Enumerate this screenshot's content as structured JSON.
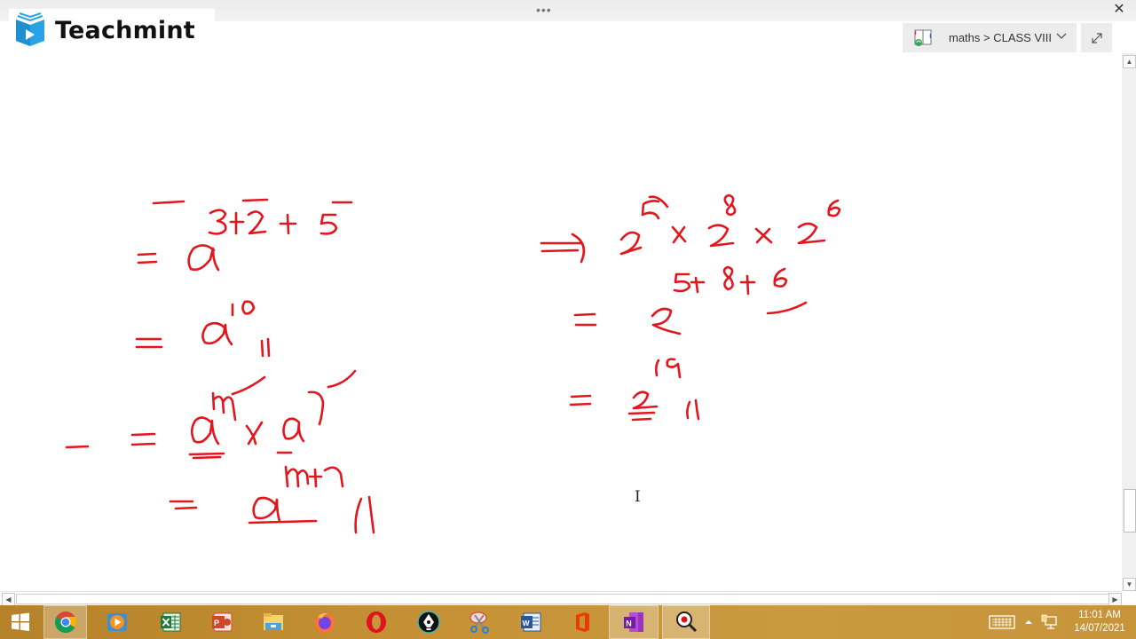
{
  "window": {
    "title_dots": "•••",
    "close_label": "✕"
  },
  "logo": {
    "brand": "Teachmint",
    "icon": "teachmint-book-play-icon"
  },
  "notebook": {
    "icon": "notebook-sync-icon",
    "label": "maths > CLASS VIII",
    "dropdown_icon": "chevron-down-icon",
    "expand_icon": "expand-diagonal-icon"
  },
  "canvas": {
    "ink_color": "#e3161e",
    "left_column": [
      {
        "line": "= a^(3+2+5)"
      },
      {
        "line": "= a^10 //"
      },
      {
        "line": "= a^m × a^n"
      },
      {
        "line": "= a^(m+n) //"
      }
    ],
    "right_column": [
      {
        "line": "⟹ 2^5 × 2^8 × 2^6"
      },
      {
        "line": "= 2^(5+8+6)"
      },
      {
        "line": "= 2^19 //"
      }
    ]
  },
  "scrollbars": {
    "up_arrow": "▲",
    "down_arrow": "▼",
    "left_arrow": "◀",
    "right_arrow": "▶"
  },
  "cursor": {
    "glyph": "I"
  },
  "taskbar": {
    "apps": [
      {
        "name": "start-button",
        "icon": "windows-logo-icon"
      },
      {
        "name": "chrome",
        "icon": "chrome-icon"
      },
      {
        "name": "media-player",
        "icon": "media-player-icon"
      },
      {
        "name": "excel",
        "icon": "excel-icon"
      },
      {
        "name": "powerpoint",
        "icon": "powerpoint-icon"
      },
      {
        "name": "file-explorer",
        "icon": "file-explorer-icon"
      },
      {
        "name": "firefox",
        "icon": "firefox-icon"
      },
      {
        "name": "opera",
        "icon": "opera-icon"
      },
      {
        "name": "pen-app",
        "icon": "pen-nib-icon"
      },
      {
        "name": "snipping-tool",
        "icon": "scissors-icon"
      },
      {
        "name": "word",
        "icon": "word-icon"
      },
      {
        "name": "office",
        "icon": "office-icon"
      },
      {
        "name": "onenote",
        "icon": "onenote-icon"
      },
      {
        "name": "screen-recorder",
        "icon": "magnifier-record-icon"
      }
    ],
    "tray": {
      "keyboard_icon": "touch-keyboard-icon",
      "show_hidden_icon": "caret-up-icon",
      "network_icon": "network-icon"
    },
    "clock": {
      "time": "11:01 AM",
      "date": "14/07/2021"
    }
  }
}
